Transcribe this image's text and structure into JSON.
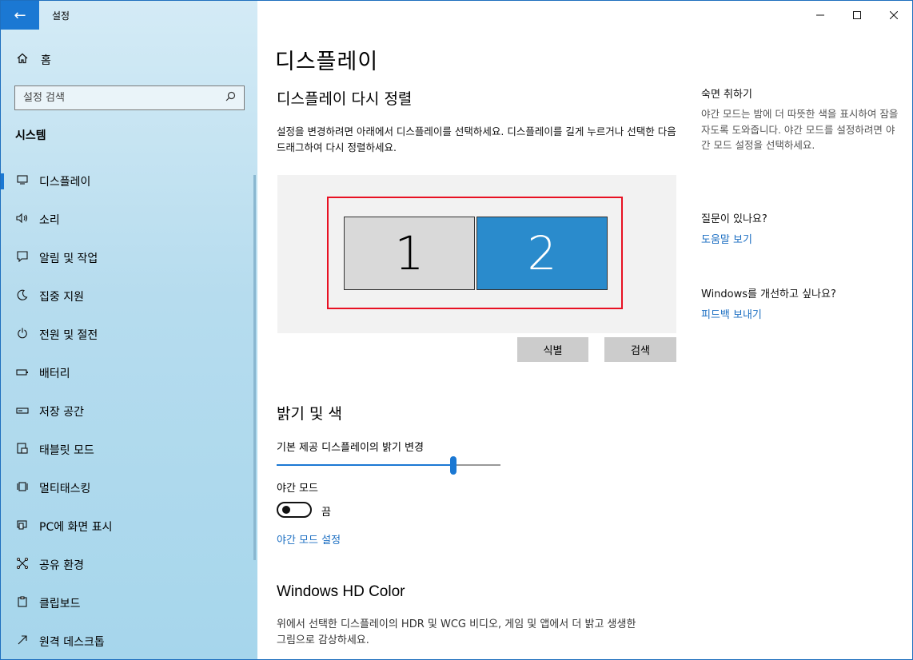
{
  "window": {
    "title": "설정",
    "accent": "#1b78d3"
  },
  "sidebar": {
    "home_label": "홈",
    "search_placeholder": "설정 검색",
    "section_heading": "시스템",
    "items": [
      {
        "label": "디스플레이",
        "icon": "monitor-icon",
        "active": true
      },
      {
        "label": "소리",
        "icon": "speaker-icon"
      },
      {
        "label": "알림 및 작업",
        "icon": "notification-icon"
      },
      {
        "label": "집중 지원",
        "icon": "moon-icon"
      },
      {
        "label": "전원 및 절전",
        "icon": "power-icon"
      },
      {
        "label": "배터리",
        "icon": "battery-icon"
      },
      {
        "label": "저장 공간",
        "icon": "storage-icon"
      },
      {
        "label": "태블릿 모드",
        "icon": "tablet-icon"
      },
      {
        "label": "멀티태스킹",
        "icon": "multitask-icon"
      },
      {
        "label": "PC에 화면 표시",
        "icon": "project-icon"
      },
      {
        "label": "공유 환경",
        "icon": "share-icon"
      },
      {
        "label": "클립보드",
        "icon": "clipboard-icon"
      },
      {
        "label": "원격 데스크톱",
        "icon": "remote-icon"
      }
    ]
  },
  "main": {
    "page_title": "디스플레이",
    "rearrange_title": "디스플레이 다시 정렬",
    "rearrange_desc": "설정을 변경하려면 아래에서 디스플레이를 선택하세요. 디스플레이를 길게 누르거나 선택한 다음 드래그하여 다시 정렬하세요.",
    "monitors": [
      "1",
      "2"
    ],
    "identify_label": "식별",
    "detect_label": "검색",
    "brightness_title": "밝기 및 색",
    "brightness_label": "기본 제공 디스플레이의 밝기 변경",
    "brightness_value": 0.79,
    "night_light_label": "야간 모드",
    "night_light_state": "끔",
    "night_light_settings_link": "야간 모드 설정",
    "hd_color_title": "Windows HD Color",
    "hd_color_desc": "위에서 선택한 디스플레이의 HDR 및 WCG 비디오, 게임 및 앱에서 더 밝고 생생한 그림으로 감상하세요."
  },
  "right_panel": {
    "sleep_title": "숙면 취하기",
    "sleep_text": "야간 모드는 밤에 더 따뜻한 색을 표시하여 잠을 자도록 도와줍니다. 야간 모드를 설정하려면 야간 모드 설정을 선택하세요.",
    "question_title": "질문이 있나요?",
    "help_link": "도움말 보기",
    "improve_title": "Windows를 개선하고 싶나요?",
    "feedback_link": "피드백 보내기"
  }
}
